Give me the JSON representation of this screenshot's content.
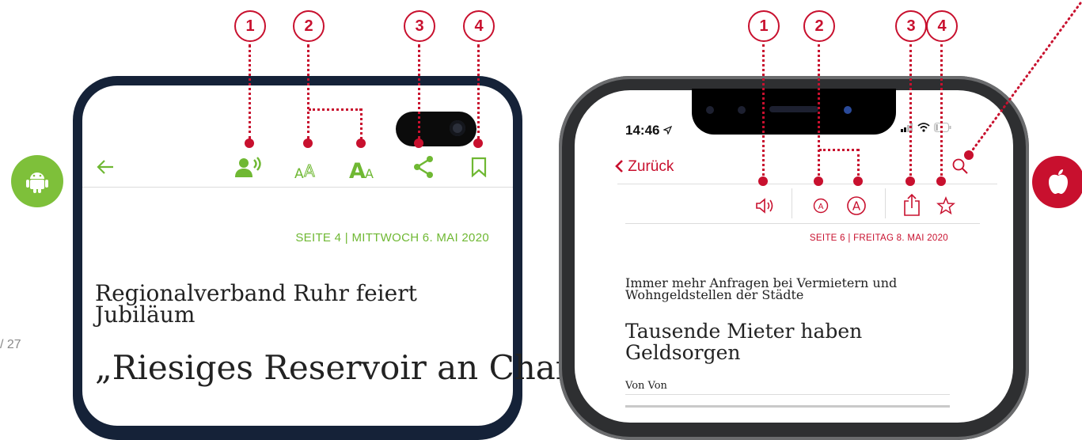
{
  "page": {
    "number": "/ 27"
  },
  "callouts": {
    "c1": "1",
    "c2": "2",
    "c3": "3",
    "c4": "4"
  },
  "android": {
    "dateline": "SEITE 4  |  MITTWOCH 6. MAI 2020",
    "kicker": "Regionalverband Ruhr feiert Jubiläum",
    "headline": "„Riesiges Reservoir an Chancen“",
    "icons": [
      "android-icon",
      "back-arrow-icon",
      "read-aloud-icon",
      "text-smaller-icon",
      "text-larger-icon",
      "share-icon",
      "bookmark-icon"
    ]
  },
  "ios": {
    "time": "14:46",
    "back_label": "Zurück",
    "dateline": "SEITE 6  |  FREITAG 8. MAI 2020",
    "kicker": "Immer mehr Anfragen bei Vermietern und Wohngeldstellen der Städte",
    "headline": "Tausende Mieter haben Geldsorgen",
    "byline": "Von Von",
    "icons": [
      "apple-icon",
      "speaker-icon",
      "text-smaller-icon",
      "text-larger-icon",
      "share-icon",
      "star-icon",
      "search-icon"
    ]
  },
  "colors": {
    "accent_red": "#c8102e",
    "android_green": "#6fb833",
    "badge_green": "#7ec03a",
    "android_frame": "#152238"
  }
}
